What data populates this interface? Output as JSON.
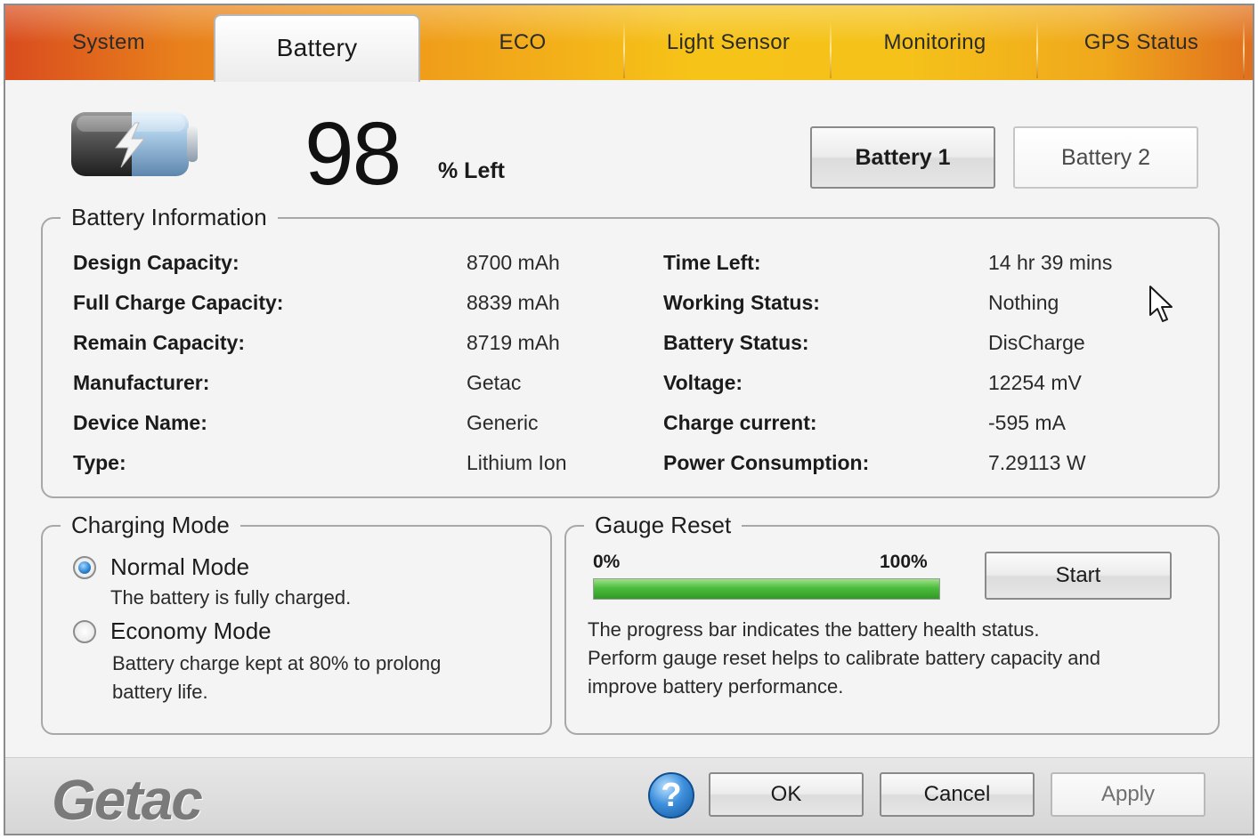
{
  "tabs": [
    {
      "label": "System"
    },
    {
      "label": "Battery"
    },
    {
      "label": "ECO"
    },
    {
      "label": "Light Sensor"
    },
    {
      "label": "Monitoring"
    },
    {
      "label": "GPS Status"
    }
  ],
  "active_tab": "Battery",
  "battery": {
    "percent": "98",
    "percent_label": "% Left",
    "battery1_label": "Battery 1",
    "battery2_label": "Battery 2",
    "selected": "Battery 1"
  },
  "info": {
    "title": "Battery Information",
    "left": [
      {
        "label": "Design Capacity:",
        "value": "8700 mAh"
      },
      {
        "label": "Full Charge Capacity:",
        "value": "8839 mAh"
      },
      {
        "label": "Remain Capacity:",
        "value": "8719 mAh"
      },
      {
        "label": "Manufacturer:",
        "value": "Getac"
      },
      {
        "label": "Device Name:",
        "value": "Generic"
      },
      {
        "label": "Type:",
        "value": "Lithium Ion"
      }
    ],
    "right": [
      {
        "label": "Time Left:",
        "value": "14 hr 39 mins"
      },
      {
        "label": "Working Status:",
        "value": "Nothing"
      },
      {
        "label": "Battery Status:",
        "value": "DisCharge"
      },
      {
        "label": "Voltage:",
        "value": "12254 mV"
      },
      {
        "label": "Charge current:",
        "value": "-595 mA"
      },
      {
        "label": "Power Consumption:",
        "value": "7.29113 W"
      }
    ]
  },
  "charging": {
    "title": "Charging Mode",
    "normal_label": "Normal Mode",
    "normal_desc": "The battery is fully charged.",
    "economy_label": "Economy Mode",
    "economy_desc_1": "Battery charge kept at 80% to prolong",
    "economy_desc_2": "battery life.",
    "selected": "Normal Mode"
  },
  "gauge": {
    "title": "Gauge Reset",
    "min_label": "0%",
    "max_label": "100%",
    "progress_fraction": 1.0,
    "start_label": "Start",
    "desc_1": "The progress bar indicates the battery health status.",
    "desc_2": "Perform gauge reset helps to calibrate battery capacity and",
    "desc_3": "improve battery performance."
  },
  "footer": {
    "logo": "Getac",
    "help_glyph": "?",
    "ok_label": "OK",
    "cancel_label": "Cancel",
    "apply_label": "Apply"
  },
  "icons": {
    "battery": "battery-charging-icon",
    "help": "help-icon",
    "cursor": "mouse-pointer-icon"
  },
  "colors": {
    "tab_orange": "#e8801c",
    "tab_yellow": "#f6c318",
    "progress_green": "#4cbc3c",
    "radio_blue": "#2a7fd0",
    "help_blue": "#3d8fdc"
  }
}
